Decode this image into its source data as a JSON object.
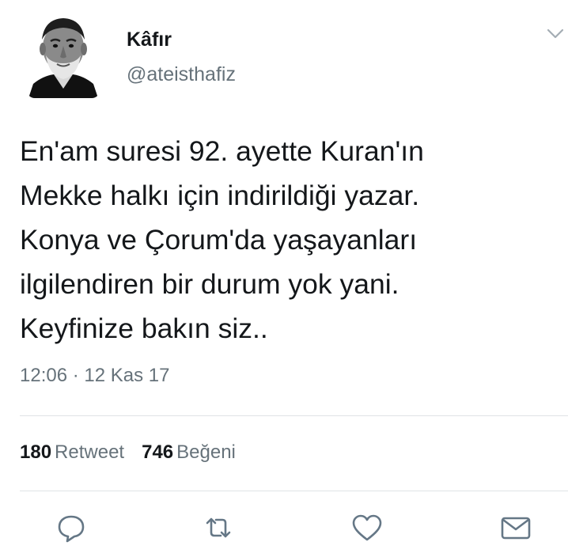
{
  "tweet": {
    "display_name": "Kâfır",
    "handle": "@ateisthafiz",
    "text": "En'am suresi 92. ayette Kuran'ın\nMekke halkı için indirildiği yazar.\nKonya ve Çorum'da yaşayanları\nilgilendiren bir durum yok yani.\nKeyfinize bakın siz..",
    "timestamp": "12:06 · 12 Kas 17"
  },
  "stats": {
    "retweet_count": "180",
    "retweet_label": "Retweet",
    "like_count": "746",
    "like_label": "Beğeni"
  },
  "icons": {
    "avatar": "profile-photo",
    "menu": "chevron-down-icon",
    "reply": "reply-icon",
    "retweet": "retweet-icon",
    "like": "heart-icon",
    "message": "envelope-icon"
  },
  "colors": {
    "text": "#14171a",
    "secondary_text": "#66727a",
    "divider": "#dfe3e6",
    "icon": "#657786"
  }
}
